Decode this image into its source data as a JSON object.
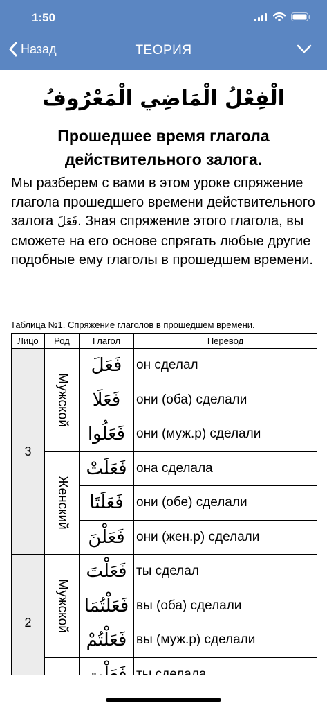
{
  "status_bar": {
    "time": "1:50"
  },
  "nav": {
    "back_label": "Назад",
    "title": "ТЕОРИЯ"
  },
  "page": {
    "arabic_title": "الْفِعْلُ الْمَاضِي الْمَعْرُوفُ",
    "title_line1": "Прошедшее время глагола",
    "title_line2": "действительного залога.",
    "intro_part1": "Мы разберем с вами в этом уроке спряжение глагола прошедшего времени действительного залога ",
    "intro_verb": "فَعَلَ",
    "intro_part2": ". Зная спряжение этого глагола, вы сможете на его основе спрягать любые другие подобные ему глаголы в прошедшем времени.",
    "table_caption": "Таблица №1. Спряжение глаголов в прошедшем времени."
  },
  "table": {
    "headers": {
      "person": "Лицо",
      "gender": "Род",
      "verb": "Глагол",
      "translation": "Перевод"
    },
    "groups": [
      {
        "person": "3",
        "genders": [
          {
            "label": "Мужской",
            "rows": [
              {
                "verb": "فَعَلَ",
                "translation": "он сделал"
              },
              {
                "verb": "فَعَلَا",
                "translation": "они (оба) сделали"
              },
              {
                "verb": "فَعَلُوا",
                "translation": "они (муж.р) сделали"
              }
            ]
          },
          {
            "label": "Женский",
            "rows": [
              {
                "verb": "فَعَلَتْ",
                "translation": "она сделала"
              },
              {
                "verb": "فَعَلَتَا",
                "translation": "они (обе) сделали"
              },
              {
                "verb": "فَعَلْنَ",
                "translation": "они (жен.р) сделали"
              }
            ]
          }
        ]
      },
      {
        "person": "2",
        "genders": [
          {
            "label": "Мужской",
            "rows": [
              {
                "verb": "فَعَلْتَ",
                "translation": "ты сделал"
              },
              {
                "verb": "فَعَلْتُمَا",
                "translation": "вы (оба) сделали"
              },
              {
                "verb": "فَعَلْتُمْ",
                "translation": "вы (муж.р) сделали"
              }
            ]
          },
          {
            "label": "",
            "rows": [
              {
                "verb": "فَعَلْتِ",
                "translation": "ты сделала"
              }
            ]
          }
        ]
      }
    ]
  },
  "colors": {
    "header_bg": "#5b86c2",
    "person_cell_bg": "#ececec"
  }
}
